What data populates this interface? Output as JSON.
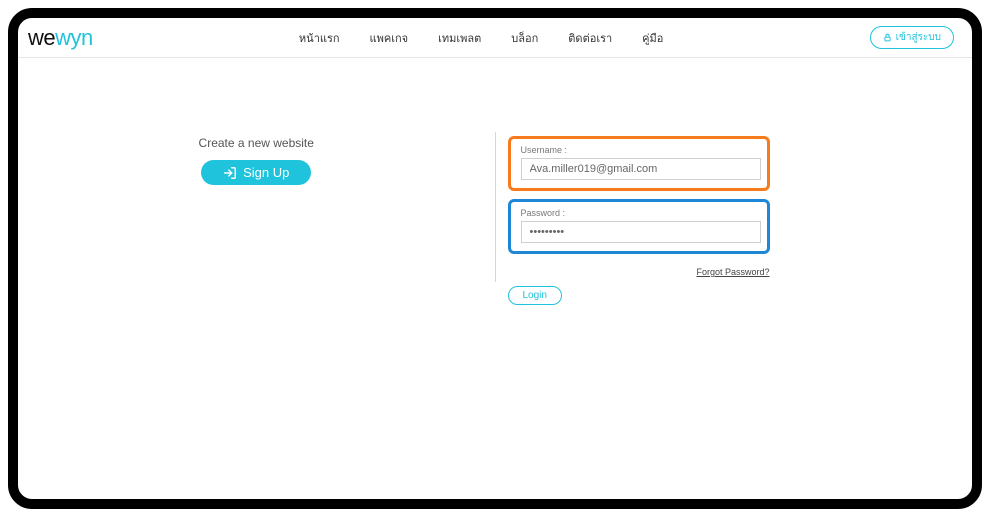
{
  "brand": {
    "part1": "we",
    "part2": "wyn"
  },
  "nav": {
    "items": [
      "หน้าแรก",
      "แพคเกจ",
      "เทมเพลต",
      "บล็อก",
      "ติดต่อเรา",
      "คู่มือ"
    ]
  },
  "header_login": {
    "label": "เข้าสู่ระบบ"
  },
  "left": {
    "create_text": "Create a new website",
    "signup_label": "Sign Up"
  },
  "form": {
    "username_label": "Username :",
    "username_value": "Ava.miller019@gmail.com",
    "password_label": "Password :",
    "password_value": "•••••••••",
    "forgot_label": "Forgot Password?",
    "login_label": "Login"
  }
}
